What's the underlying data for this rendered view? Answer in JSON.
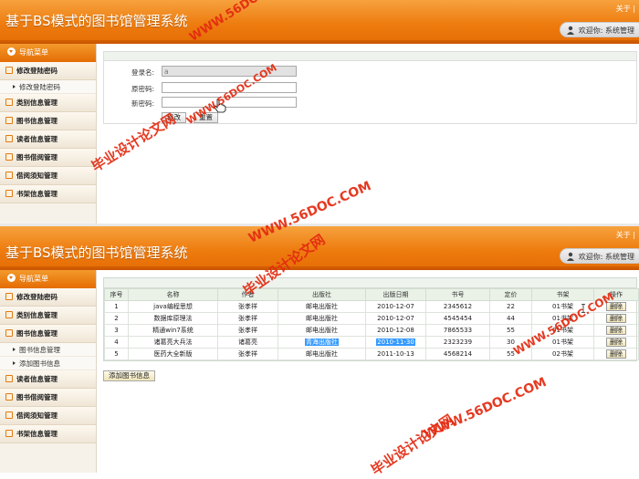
{
  "app_title": "基于BS模式的图书馆管理系统",
  "top_link": "关于 |",
  "user_greeting": "欢迎你: 系统管理",
  "nav_header": "导航菜单",
  "panel1": {
    "nav": [
      {
        "type": "item",
        "label": "修改登陆密码"
      },
      {
        "type": "sub",
        "label": "修改登陆密码"
      },
      {
        "type": "item",
        "label": "类别信息管理"
      },
      {
        "type": "item",
        "label": "图书信息管理"
      },
      {
        "type": "item",
        "label": "读者信息管理"
      },
      {
        "type": "item",
        "label": "图书借阅管理"
      },
      {
        "type": "item",
        "label": "借阅须知管理"
      },
      {
        "type": "item",
        "label": "书架信息管理"
      }
    ],
    "form": {
      "username_label": "登录名:",
      "username_value": "a",
      "old_password_label": "原密码:",
      "new_password_label": "新密码:",
      "submit_label": "修改",
      "reset_label": "重置"
    }
  },
  "panel2": {
    "nav": [
      {
        "type": "item",
        "label": "修改登陆密码"
      },
      {
        "type": "item",
        "label": "类别信息管理"
      },
      {
        "type": "item",
        "label": "图书信息管理"
      },
      {
        "type": "sub",
        "label": "图书信息管理"
      },
      {
        "type": "sub",
        "label": "添加图书信息"
      },
      {
        "type": "item",
        "label": "读者信息管理"
      },
      {
        "type": "item",
        "label": "图书借阅管理"
      },
      {
        "type": "item",
        "label": "借阅须知管理"
      },
      {
        "type": "item",
        "label": "书架信息管理"
      }
    ],
    "table": {
      "headers": [
        "序号",
        "名称",
        "作者",
        "出版社",
        "出版日期",
        "书号",
        "定价",
        "书架",
        "操作"
      ],
      "rows": [
        [
          "1",
          "java编程思想",
          "张孝祥",
          "邮电出版社",
          "2010-12-07",
          "2345612",
          "22",
          "01书架",
          "删除"
        ],
        [
          "2",
          "数据库原理法",
          "张孝祥",
          "邮电出版社",
          "2010-12-07",
          "4545454",
          "44",
          "01书架",
          "删除"
        ],
        [
          "3",
          "精通win7系统",
          "张孝祥",
          "邮电出版社",
          "2010-12-08",
          "7865533",
          "55",
          "01书架",
          "删除"
        ],
        [
          "4",
          "诸葛亮大兵法",
          "诸葛亮",
          "青海出版社",
          "2010-11-30",
          "2323239",
          "30",
          "01书架",
          "删除"
        ],
        [
          "5",
          "医药大全新版",
          "张孝祥",
          "邮电出版社",
          "2011-10-13",
          "4568214",
          "55",
          "02书架",
          "删除"
        ]
      ]
    },
    "add_button": "添加图书信息"
  },
  "watermarks": {
    "site": "WWW.56DOC.COM",
    "text": "毕业设计论文网"
  },
  "colors": {
    "header_orange": "#ee7c0f",
    "watermark_red": "#e32a10",
    "selection_blue": "#3399ff"
  }
}
